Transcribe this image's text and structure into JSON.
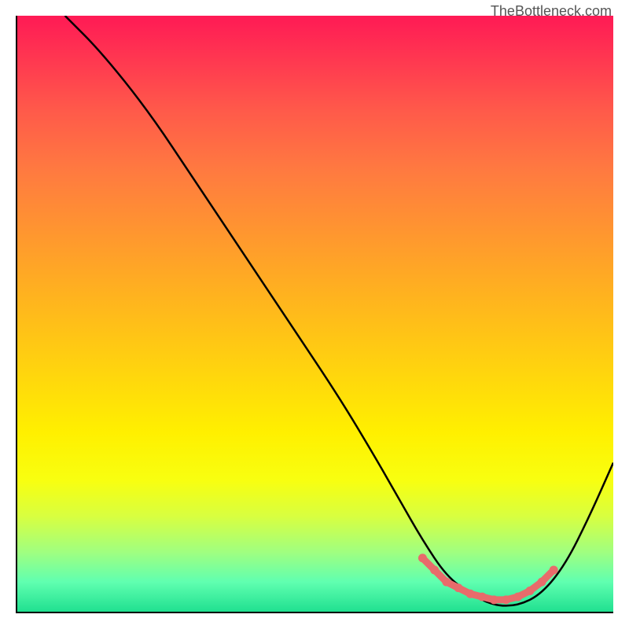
{
  "watermark": "TheBottleneck.com",
  "chart_data": {
    "type": "line",
    "title": "",
    "xlabel": "",
    "ylabel": "",
    "xlim": [
      0,
      100
    ],
    "ylim": [
      0,
      100
    ],
    "series": [
      {
        "name": "bottleneck-curve",
        "x": [
          8,
          14,
          22,
          30,
          38,
          46,
          54,
          60,
          64,
          68,
          72,
          76,
          80,
          84,
          88,
          92,
          96,
          100
        ],
        "y": [
          100,
          94,
          84,
          72,
          60,
          48,
          36,
          26,
          19,
          12,
          6,
          3,
          1,
          1,
          3,
          8,
          16,
          25
        ],
        "color": "#000000"
      }
    ],
    "markers": {
      "name": "optimal-range-dots",
      "x": [
        68,
        70,
        72,
        74,
        76,
        78,
        80,
        82,
        84,
        86,
        88,
        90
      ],
      "y": [
        9,
        7,
        5,
        4,
        3,
        2.5,
        2,
        2,
        2.5,
        3.5,
        5,
        7
      ],
      "color": "#e86b6b"
    },
    "gradient_background": {
      "top_color": "#ff1a55",
      "mid_color": "#ffd000",
      "bottom_color": "#20e090"
    }
  }
}
